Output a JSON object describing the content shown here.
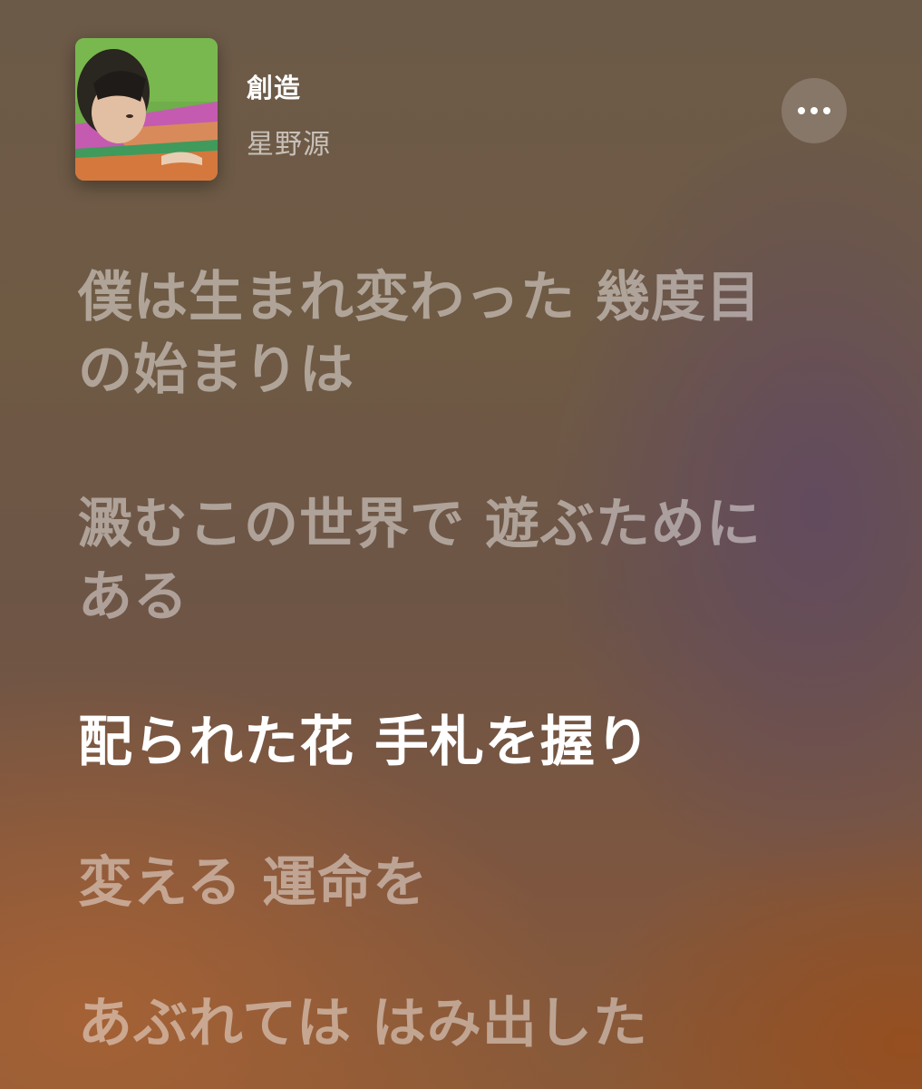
{
  "now_playing": {
    "title": "創造",
    "artist": "星野源",
    "artwork_icon": "album-artwork",
    "more_icon": "ellipsis-icon"
  },
  "lyrics": [
    {
      "text": "僕は生まれ変わった 幾度目の始まりは",
      "active": false
    },
    {
      "text": "澱むこの世界で 遊ぶためにある",
      "active": false
    },
    {
      "text": "配られた花 手札を握り",
      "active": true
    },
    {
      "text": "変える 運命を",
      "active": false
    },
    {
      "text": "あぶれては はみ出した",
      "active": false
    }
  ],
  "colors": {
    "active_lyric": "#ffffff",
    "inactive_lyric": "rgba(255,255,255,0.45)",
    "artist_text": "rgba(255,255,255,0.62)"
  }
}
